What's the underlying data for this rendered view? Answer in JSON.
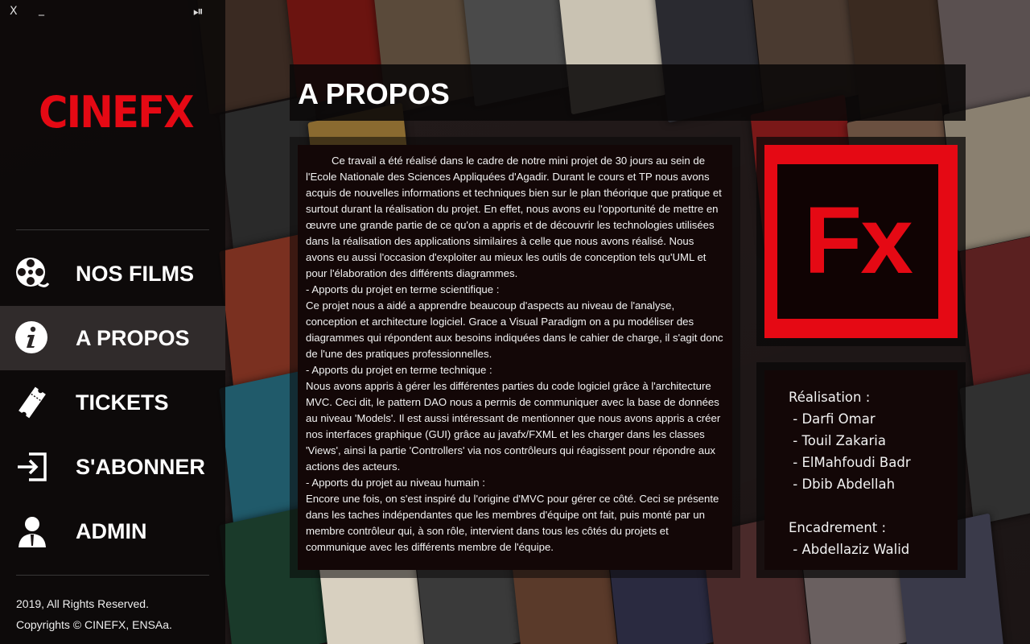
{
  "window": {
    "close": "X",
    "minimize": "_",
    "media": "⏯"
  },
  "brand": {
    "logo": "CINEFX",
    "accent": "#e50914"
  },
  "nav": [
    {
      "label": "NOS FILMS",
      "icon": "film-reel-icon"
    },
    {
      "label": "A PROPOS",
      "icon": "info-icon",
      "active": true
    },
    {
      "label": "TICKETS",
      "icon": "ticket-icon"
    },
    {
      "label": "S'ABONNER",
      "icon": "sign-in-icon"
    },
    {
      "label": "ADMIN",
      "icon": "admin-user-icon"
    }
  ],
  "footer": {
    "line1": "2019, All Rights Reserved.",
    "line2": "Copyrights © CINEFX, ENSAa."
  },
  "page": {
    "title": "A PROPOS"
  },
  "about": {
    "paragraphs": [
      "Ce travail a été réalisé dans le cadre de notre mini projet de 30 jours au sein de l'Ecole Nationale des Sciences Appliquées d'Agadir. Durant le cours et TP nous avons acquis de nouvelles informations et techniques bien sur le plan théorique que pratique et surtout durant la réalisation du projet. En effet, nous avons eu l'opportunité de mettre en œuvre une grande partie de ce qu'on a appris et de découvrir les technologies utilisées dans la réalisation des applications similaires à celle que nous avons réalisé. Nous avons eu aussi l'occasion d'exploiter au mieux les outils de conception tels qu'UML et pour l'élaboration des différents diagrammes.",
      "- Apports du projet en terme scientifique :",
      "Ce projet nous a aidé a apprendre beaucoup d'aspects au niveau de l'analyse, conception et architecture logiciel. Grace a Visual Paradigm on a pu modéliser des diagrammes qui répondent aux besoins indiquées dans le cahier de charge, il s'agit donc de l'une des pratiques professionnelles.",
      "- Apports du projet en terme technique :",
      "Nous avons appris à gérer les différentes parties du code logiciel grâce à l'architecture MVC. Ceci dit, le pattern DAO nous a permis de communiquer avec la base de données au niveau 'Models'. Il est aussi intéressant de mentionner que nous avons appris a créer nos interfaces graphique (GUI) grâce au javafx/FXML et les charger dans les classes 'Views', ainsi la partie 'Controllers' via nos contrôleurs qui réagissent pour répondre aux actions des acteurs.",
      "- Apports du projet au niveau humain :",
      "Encore une fois, on s'est inspiré du l'origine d'MVC pour gérer ce côté. Ceci se présente dans les taches indépendantes que les membres d'équipe ont fait, puis monté par un membre contrôleur qui, à son rôle, intervient dans tous les côtés du projets et communique avec les différents membre de l'équipe."
    ]
  },
  "fx_logo": {
    "text": "Fx"
  },
  "credits": {
    "realisation_label": "Réalisation :",
    "members": [
      " - Darfi Omar",
      " - Touil Zakaria",
      " - ElMahfoudi Badr",
      " - Dbib Abdellah"
    ],
    "encadrement_label": "Encadrement :",
    "supervisor": " - Abdellaziz Walid"
  }
}
